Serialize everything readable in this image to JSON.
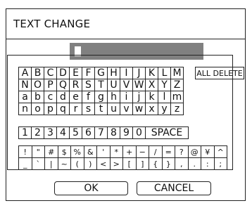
{
  "dialog": {
    "title": "TEXT CHANGE"
  },
  "buttons": {
    "all_delete": "ALL DELETE",
    "ok": "OK",
    "cancel": "CANCEL"
  },
  "keyboard": {
    "upper1": [
      "A",
      "B",
      "C",
      "D",
      "E",
      "F",
      "G",
      "H",
      "I",
      "J",
      "K",
      "L",
      "M"
    ],
    "upper2": [
      "N",
      "O",
      "P",
      "Q",
      "R",
      "S",
      "T",
      "U",
      "V",
      "W",
      "X",
      "Y",
      "Z"
    ],
    "lower1": [
      "a",
      "b",
      "c",
      "d",
      "e",
      "f",
      "g",
      "h",
      "i",
      "j",
      "k",
      "l",
      "m"
    ],
    "lower2": [
      "n",
      "o",
      "p",
      "q",
      "r",
      "s",
      "t",
      "u",
      "v",
      "w",
      "x",
      "y",
      "z"
    ],
    "digits": [
      "1",
      "2",
      "3",
      "4",
      "5",
      "6",
      "7",
      "8",
      "9",
      "0"
    ],
    "space": "SPACE",
    "sym1": [
      "!",
      "\"",
      "#",
      "$",
      "%",
      "&",
      "'",
      "*",
      "+",
      "−",
      "/",
      "=",
      "?",
      "@",
      "¥",
      "^"
    ],
    "sym2": [
      "_",
      "`",
      "|",
      "~",
      "(",
      ")",
      "<",
      ">",
      "[",
      "]",
      "{",
      "}",
      ",",
      ".",
      ":",
      ";"
    ]
  }
}
